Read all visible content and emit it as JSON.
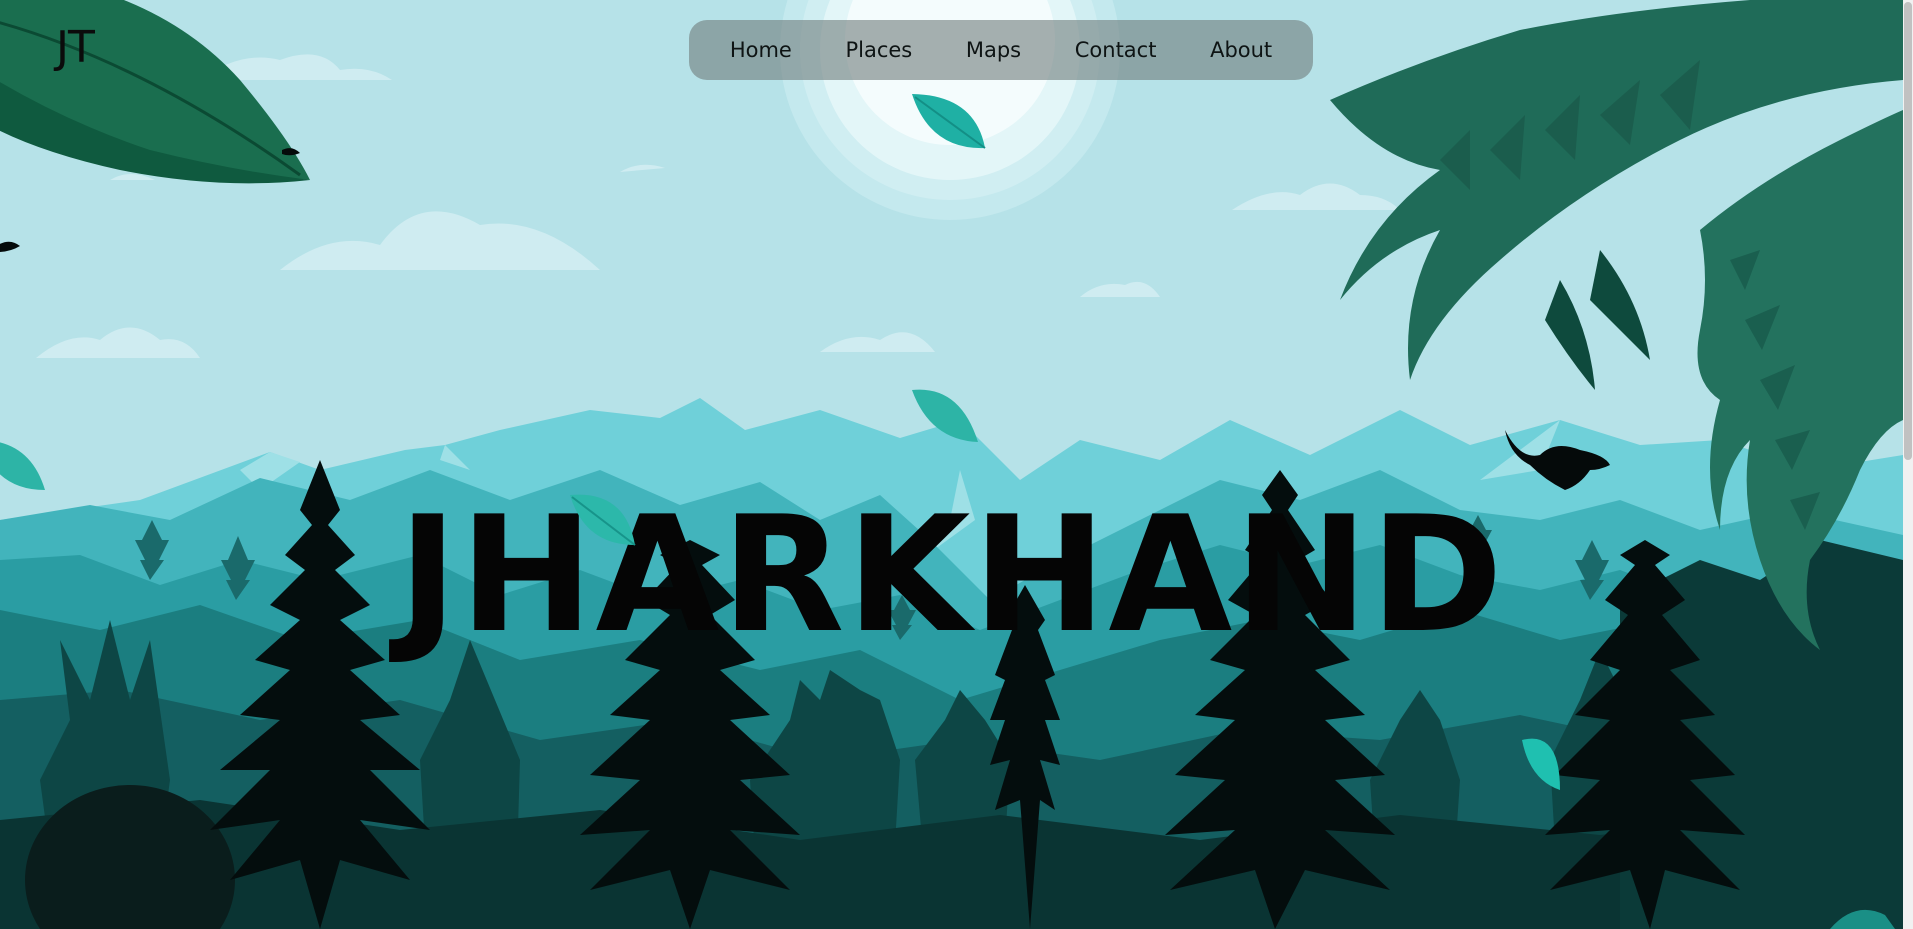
{
  "brand": {
    "logo_text": "JT"
  },
  "nav": {
    "items": [
      {
        "label": "Home"
      },
      {
        "label": "Places"
      },
      {
        "label": "Maps"
      },
      {
        "label": "Contact"
      },
      {
        "label": "About"
      }
    ]
  },
  "hero": {
    "title": "JHARKHAND"
  },
  "icons": {
    "leaf": "falling-leaf-icon",
    "bird": "bird-icon"
  },
  "colors": {
    "sky": "#b6e2e8",
    "mountain_light": "#5cc7d2",
    "forest_dark": "#0b3a38",
    "fern": "#1f6b58"
  }
}
